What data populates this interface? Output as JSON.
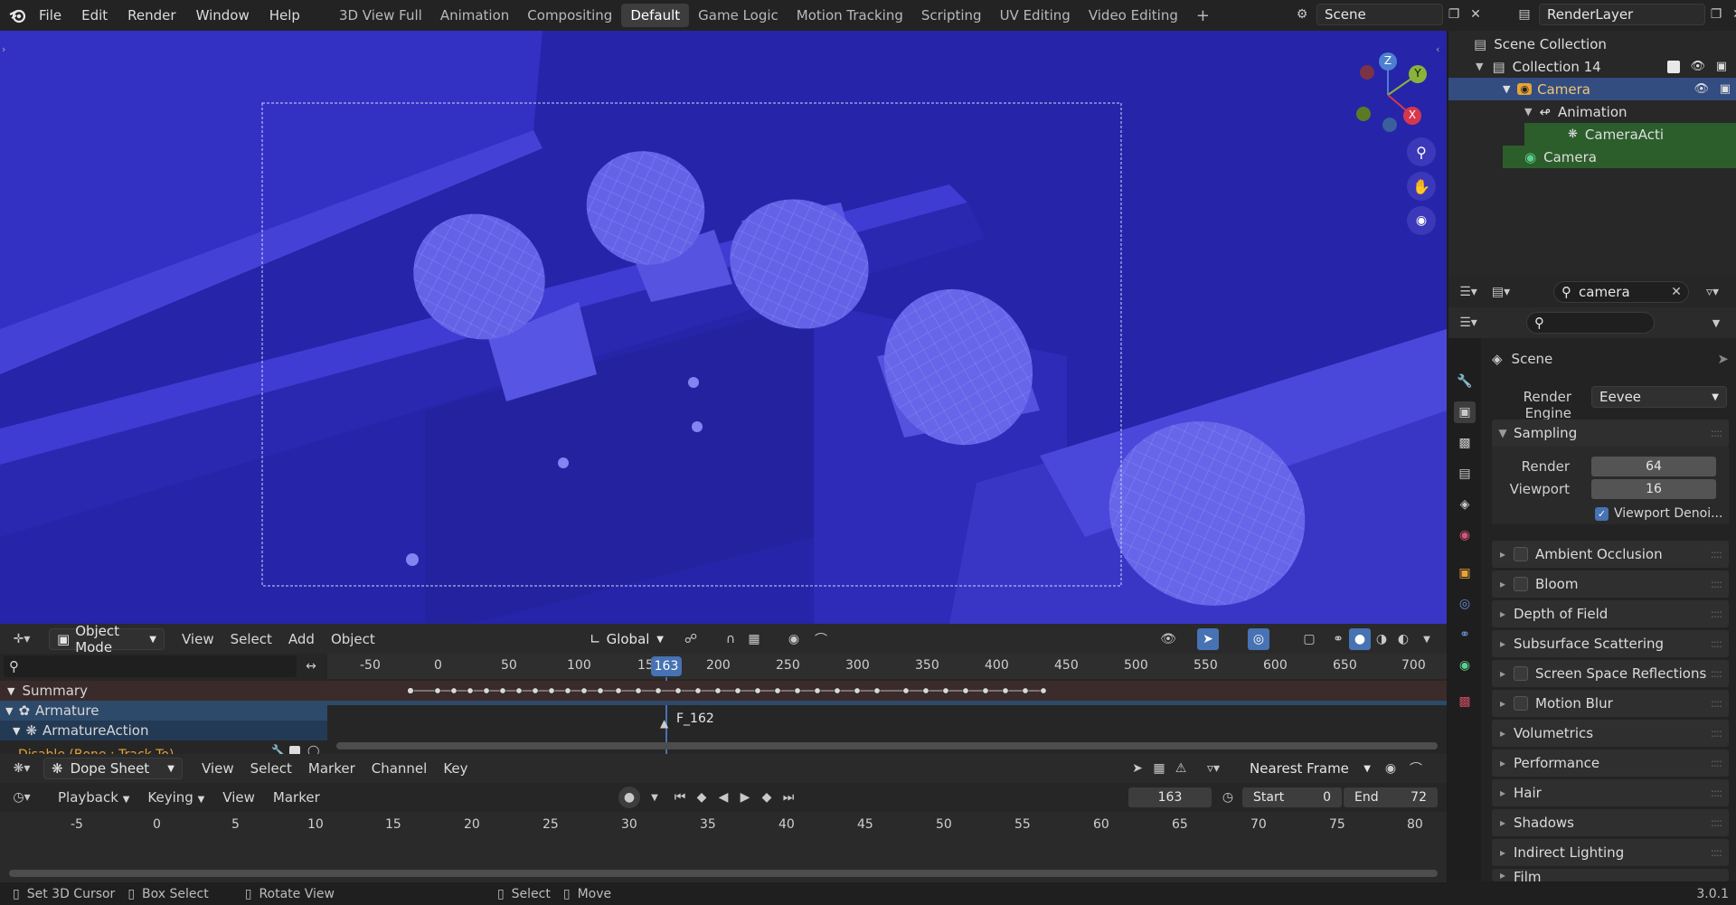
{
  "topbar": {
    "menus": [
      "File",
      "Edit",
      "Render",
      "Window",
      "Help"
    ],
    "workspaces": [
      "3D View Full",
      "Animation",
      "Compositing",
      "Default",
      "Game Logic",
      "Motion Tracking",
      "Scripting",
      "UV Editing",
      "Video Editing"
    ],
    "active_workspace": "Default",
    "scene": "Scene",
    "view_layer": "RenderLayer",
    "add_label": "+"
  },
  "viewport": {
    "header": {
      "mode": "Object Mode",
      "menus": [
        "View",
        "Select",
        "Add",
        "Object"
      ],
      "orientation": "Global"
    },
    "gizmo": {
      "z": "Z",
      "y": "Y",
      "x": "X"
    },
    "bg_color": "#2624a8"
  },
  "outliner": {
    "root": "Scene Collection",
    "collection": "Collection 14",
    "camera_obj": "Camera",
    "animation": "Animation",
    "action": "CameraActi",
    "camera_data": "Camera"
  },
  "properties": {
    "search_value": "camera",
    "scene_label": "Scene",
    "render_engine_label": "Render Engine",
    "render_engine": "Eevee",
    "sampling": {
      "title": "Sampling",
      "render_label": "Render",
      "render_value": "64",
      "viewport_label": "Viewport",
      "viewport_value": "16",
      "denoise_label": "Viewport Denoi..."
    },
    "panels": [
      {
        "label": "Ambient Occlusion",
        "checkbox": true
      },
      {
        "label": "Bloom",
        "checkbox": true
      },
      {
        "label": "Depth of Field",
        "checkbox": false
      },
      {
        "label": "Subsurface Scattering",
        "checkbox": false
      },
      {
        "label": "Screen Space Reflections",
        "checkbox": true
      },
      {
        "label": "Motion Blur",
        "checkbox": true
      },
      {
        "label": "Volumetrics",
        "checkbox": false
      },
      {
        "label": "Performance",
        "checkbox": false
      },
      {
        "label": "Hair",
        "checkbox": false
      },
      {
        "label": "Shadows",
        "checkbox": false
      },
      {
        "label": "Indirect Lighting",
        "checkbox": false
      },
      {
        "label": "Film",
        "checkbox": false
      }
    ]
  },
  "dopesheet": {
    "ruler": [
      "-50",
      "0",
      "50",
      "100",
      "15",
      "200",
      "250",
      "300",
      "350",
      "400",
      "450",
      "500",
      "550",
      "600",
      "650",
      "700"
    ],
    "current_frame": "163",
    "channels": {
      "summary": "Summary",
      "armature": "Armature",
      "action": "ArmatureAction",
      "constraint": "Disable (Bone : Track To)"
    },
    "marker": "F_162",
    "header": {
      "editor": "Dope Sheet",
      "menus": [
        "View",
        "Select",
        "Marker",
        "Channel",
        "Key"
      ],
      "snap": "Nearest Frame"
    }
  },
  "timeline": {
    "menus": [
      "Playback",
      "Keying",
      "View",
      "Marker"
    ],
    "frame": "163",
    "start_label": "Start",
    "start": "0",
    "end_label": "End",
    "end": "72",
    "ruler": [
      "-5",
      "0",
      "5",
      "10",
      "15",
      "20",
      "25",
      "30",
      "35",
      "40",
      "45",
      "50",
      "55",
      "60",
      "65",
      "70",
      "75",
      "80"
    ]
  },
  "statusbar": {
    "items": [
      "Set 3D Cursor",
      "Box Select",
      "Rotate View",
      "Select",
      "Move"
    ],
    "version": "3.0.1"
  }
}
